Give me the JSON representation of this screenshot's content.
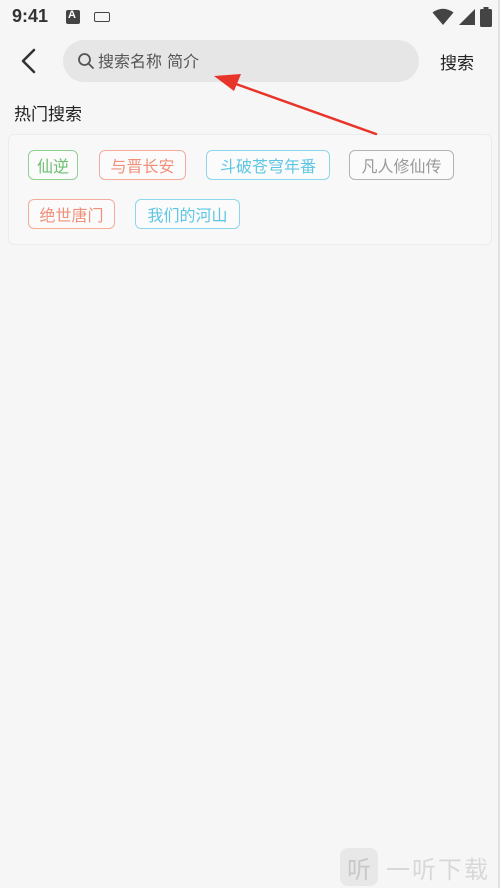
{
  "status_bar": {
    "time": "9:41"
  },
  "header": {
    "back_icon": "chevron-left-icon",
    "search": {
      "placeholder": "搜索名称 简介",
      "value": ""
    },
    "search_button_label": "搜索"
  },
  "hot_search": {
    "title": "热门搜索",
    "tags": [
      {
        "label": "仙逆",
        "color": "#6cc070"
      },
      {
        "label": "与晋长安",
        "color": "#f0907a"
      },
      {
        "label": "斗破苍穹年番",
        "color": "#5ec6e4"
      },
      {
        "label": "凡人修仙传",
        "color": "#9a9a9a"
      },
      {
        "label": "绝世唐门",
        "color": "#f0907a"
      },
      {
        "label": "我们的河山",
        "color": "#5ec6e4"
      }
    ]
  },
  "watermark": {
    "logo_char": "听",
    "text": "一听下载"
  },
  "annotation": {
    "arrow_color": "#e8352a"
  }
}
